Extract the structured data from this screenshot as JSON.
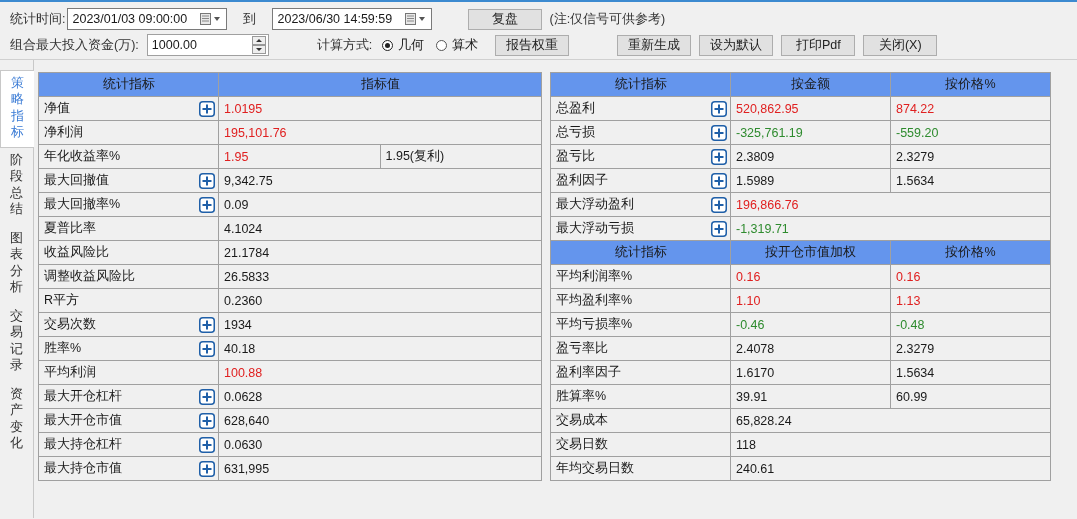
{
  "toolbar": {
    "time_label": "统计时间:",
    "start": "2023/01/03 09:00:00",
    "to_label": "到",
    "end": "2023/06/30 14:59:59",
    "replay_button": "复盘",
    "note": "(注:仅信号可供参考)",
    "capital_label": "组合最大投入资金(万):",
    "capital": "1000.00",
    "method_label": "计算方式:",
    "methods": [
      {
        "label": "几何",
        "selected": true
      },
      {
        "label": "算术",
        "selected": false
      }
    ],
    "report_button": "报告权重",
    "buttons": [
      "重新生成",
      "设为默认",
      "打印Pdf",
      "关闭(X)"
    ]
  },
  "side_tabs": [
    {
      "label": "策略指标",
      "selected": true
    },
    {
      "label": "阶段总结",
      "selected": false
    },
    {
      "label": "图表分析",
      "selected": false
    },
    {
      "label": "交易记录",
      "selected": false
    },
    {
      "label": "资产变化",
      "selected": false
    }
  ],
  "left_table": {
    "sections": [
      {
        "columns": [
          "统计指标",
          "指标值"
        ],
        "rows": [
          {
            "label": "净值",
            "detail": true,
            "values": [
              {
                "text": "1.0195",
                "color": "#e02020"
              }
            ]
          },
          {
            "label": "净利润",
            "detail": false,
            "values": [
              {
                "text": "195,101.76",
                "color": "#e02020"
              }
            ]
          },
          {
            "label": "年化收益率%",
            "detail": false,
            "values": [
              {
                "text": "1.95",
                "color": "#e02020"
              },
              {
                "text": "1.95(复利)"
              }
            ]
          },
          {
            "label": "最大回撤值",
            "detail": true,
            "values": [
              {
                "text": "9,342.75"
              }
            ]
          },
          {
            "label": "最大回撤率%",
            "detail": true,
            "values": [
              {
                "text": "0.09"
              }
            ]
          },
          {
            "label": "夏普比率",
            "detail": false,
            "values": [
              {
                "text": "4.1024"
              }
            ]
          },
          {
            "label": "收益风险比",
            "detail": false,
            "values": [
              {
                "text": "21.1784"
              }
            ]
          },
          {
            "label": "调整收益风险比",
            "detail": false,
            "values": [
              {
                "text": "26.5833"
              }
            ]
          },
          {
            "label": "R平方",
            "detail": false,
            "values": [
              {
                "text": "0.2360"
              }
            ]
          },
          {
            "label": "交易次数",
            "detail": true,
            "values": [
              {
                "text": "1934"
              }
            ]
          },
          {
            "label": "胜率%",
            "detail": true,
            "values": [
              {
                "text": "40.18"
              }
            ]
          },
          {
            "label": "平均利润",
            "detail": false,
            "values": [
              {
                "text": "100.88",
                "color": "#e02020"
              }
            ]
          },
          {
            "label": "最大开仓杠杆",
            "detail": true,
            "values": [
              {
                "text": "0.0628"
              }
            ]
          },
          {
            "label": "最大开仓市值",
            "detail": true,
            "values": [
              {
                "text": "628,640"
              }
            ]
          },
          {
            "label": "最大持仓杠杆",
            "detail": true,
            "values": [
              {
                "text": "0.0630"
              }
            ]
          },
          {
            "label": "最大持仓市值",
            "detail": true,
            "values": [
              {
                "text": "631,995"
              }
            ]
          }
        ]
      }
    ]
  },
  "right_table": {
    "sections": [
      {
        "columns": [
          "统计指标",
          "按金额",
          "按价格%"
        ],
        "rows": [
          {
            "label": "总盈利",
            "detail": true,
            "values": [
              {
                "text": "520,862.95",
                "color": "#e02020"
              },
              {
                "text": "874.22",
                "color": "#e02020"
              }
            ]
          },
          {
            "label": "总亏损",
            "detail": true,
            "values": [
              {
                "text": "-325,761.19",
                "color": "#2e8b2e"
              },
              {
                "text": "-559.20",
                "color": "#2e8b2e"
              }
            ]
          },
          {
            "label": "盈亏比",
            "detail": true,
            "values": [
              {
                "text": "2.3809"
              },
              {
                "text": "2.3279"
              }
            ]
          },
          {
            "label": "盈利因子",
            "detail": true,
            "values": [
              {
                "text": "1.5989"
              },
              {
                "text": "1.5634"
              }
            ]
          },
          {
            "label": "最大浮动盈利",
            "detail": true,
            "values": [
              {
                "text": "196,866.76",
                "color": "#e02020"
              }
            ]
          },
          {
            "label": "最大浮动亏损",
            "detail": true,
            "values": [
              {
                "text": "-1,319.71",
                "color": "#2e8b2e"
              }
            ]
          }
        ]
      },
      {
        "columns": [
          "统计指标",
          "按开仓市值加权",
          "按价格%"
        ],
        "rows": [
          {
            "label": "平均利润率%",
            "detail": false,
            "values": [
              {
                "text": "0.16",
                "color": "#e02020"
              },
              {
                "text": "0.16",
                "color": "#e02020"
              }
            ]
          },
          {
            "label": "平均盈利率%",
            "detail": false,
            "values": [
              {
                "text": "1.10",
                "color": "#e02020"
              },
              {
                "text": "1.13",
                "color": "#e02020"
              }
            ]
          },
          {
            "label": "平均亏损率%",
            "detail": false,
            "values": [
              {
                "text": "-0.46",
                "color": "#2e8b2e"
              },
              {
                "text": "-0.48",
                "color": "#2e8b2e"
              }
            ]
          },
          {
            "label": "盈亏率比",
            "detail": false,
            "values": [
              {
                "text": "2.4078"
              },
              {
                "text": "2.3279"
              }
            ]
          },
          {
            "label": "盈利率因子",
            "detail": false,
            "values": [
              {
                "text": "1.6170"
              },
              {
                "text": "1.5634"
              }
            ]
          },
          {
            "label": "胜算率%",
            "detail": false,
            "values": [
              {
                "text": "39.91"
              },
              {
                "text": "60.99"
              }
            ]
          },
          {
            "label": "交易成本",
            "detail": false,
            "values": [
              {
                "text": "65,828.24"
              }
            ]
          },
          {
            "label": "交易日数",
            "detail": false,
            "values": [
              {
                "text": "118"
              }
            ]
          },
          {
            "label": "年均交易日数",
            "detail": false,
            "values": [
              {
                "text": "240.61"
              }
            ]
          }
        ]
      }
    ]
  }
}
